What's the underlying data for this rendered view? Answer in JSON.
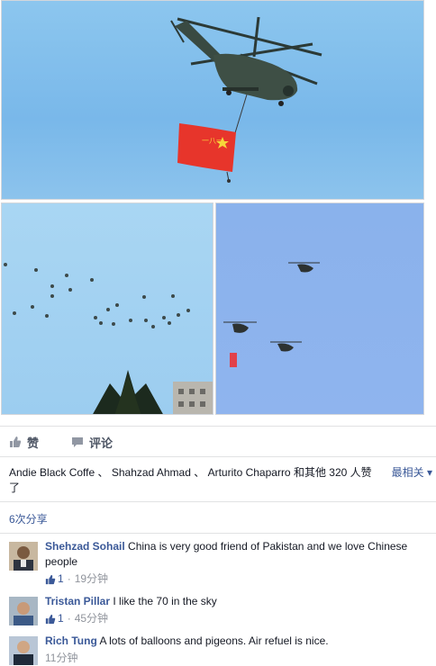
{
  "post": {
    "photos": [
      {
        "name": "photo-helicopter-flag",
        "alt": "Helicopter carrying flag"
      },
      {
        "name": "photo-aircraft-formation",
        "alt": "Aircraft formation over trees"
      },
      {
        "name": "photo-three-helicopters",
        "alt": "Three helicopters with flag"
      }
    ],
    "flag_text": "一八一",
    "actions": {
      "like_label": "赞",
      "comment_label": "评论"
    },
    "likes": {
      "names_text": "Andie Black Coffe 、 Shahzad Ahmad 、 Arturito Chaparro 和其他 320 人赞了",
      "sort_label": "最相关 ▾"
    },
    "shares_text": "6次分享"
  },
  "comments": [
    {
      "author": "Shehzad Sohail",
      "text": "China is very good friend of Pakistan and we love Chinese people",
      "likes": "1",
      "time": "19分钟"
    },
    {
      "author": "Tristan Pillar",
      "text": "I like the 70 in the sky",
      "likes": "1",
      "time": "45分钟"
    },
    {
      "author": "Rich Tung",
      "text": "A lots of balloons and pigeons. Air refuel is nice.",
      "likes": "",
      "time": "11分钟"
    }
  ],
  "colors": {
    "link": "#3b5998",
    "flag": "#e7352b",
    "sky": "#7fbbea"
  },
  "icons": {
    "like": "thumbs-up-icon",
    "comment": "speech-bubble-icon"
  }
}
